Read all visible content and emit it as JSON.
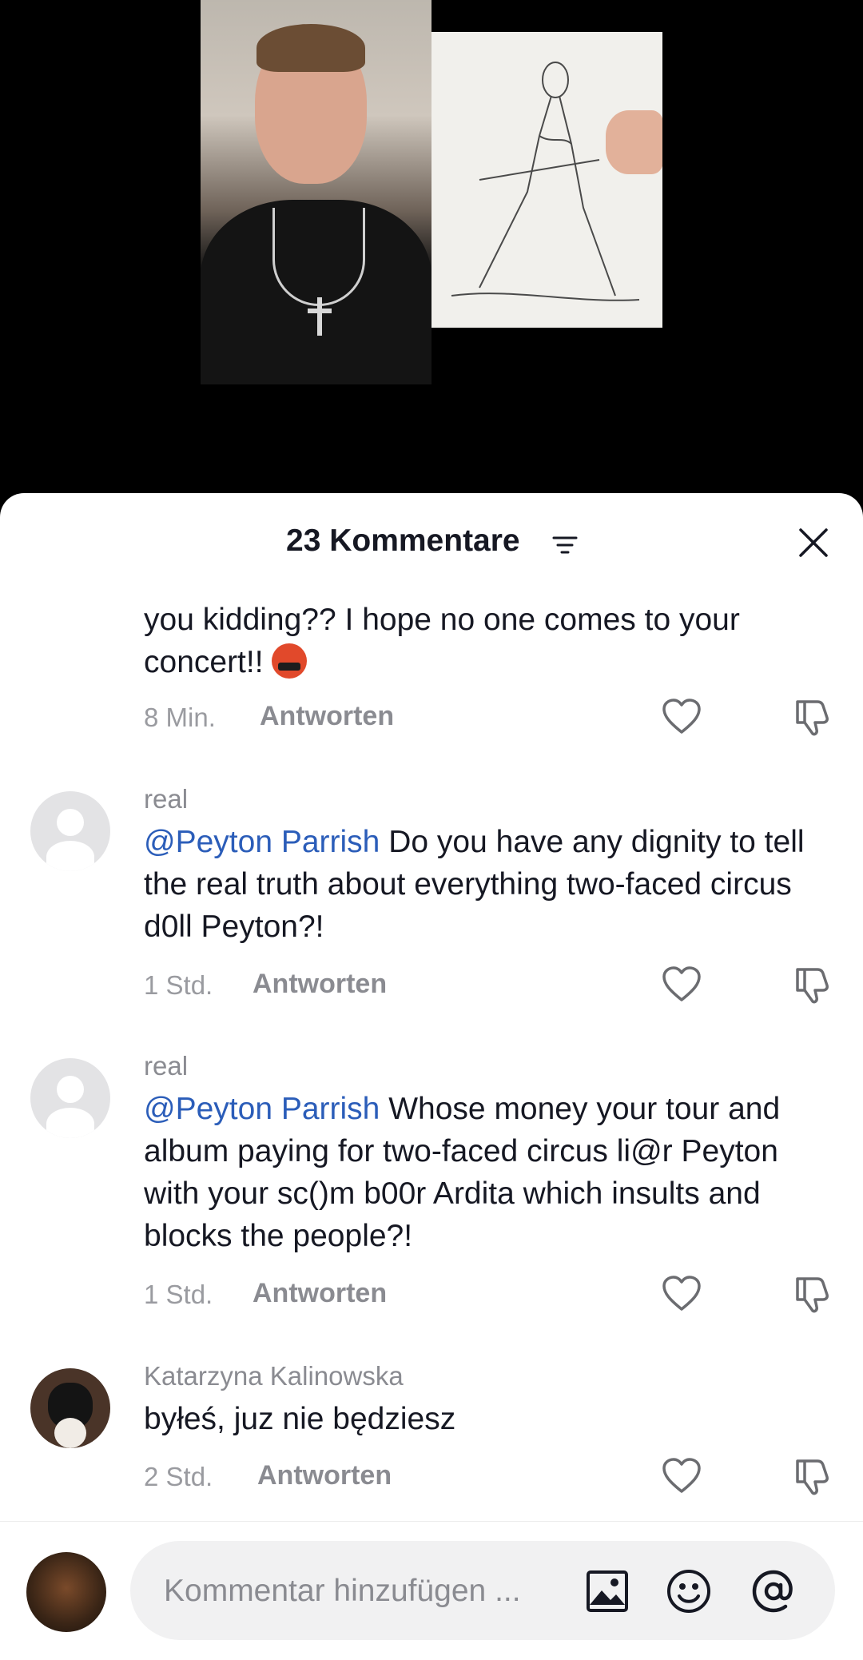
{
  "header": {
    "title": "23 Kommentare"
  },
  "comments": [
    {
      "username": "",
      "text": "you kidding?? I hope no one comes to your concert!!",
      "time": "8 Min.",
      "reply_label": "Antworten"
    },
    {
      "username": "real",
      "mention": "@Peyton Parrish",
      "text": " Do you have any dignity to tell the real truth about everything two-faced circus d0ll Peyton?!",
      "time": "1 Std.",
      "reply_label": "Antworten"
    },
    {
      "username": "real",
      "mention": "@Peyton Parrish",
      "text": " Whose money your tour and album paying for two-faced circus li@r Peyton with your sc()m b00r Ardita which insults and blocks the people?!",
      "time": "1 Std.",
      "reply_label": "Antworten"
    },
    {
      "username": "Katarzyna Kalinowska",
      "text": "byłeś, juz nie będziesz",
      "time": "2 Std.",
      "reply_label": "Antworten"
    }
  ],
  "composer": {
    "placeholder": "Kommentar hinzufügen ..."
  },
  "icons": {
    "filter": "filter-icon",
    "close": "close-icon",
    "like": "heart-icon",
    "dislike": "thumbs-down-icon",
    "image": "image-icon",
    "emoji": "emoji-icon",
    "mention": "at-icon"
  },
  "colors": {
    "mention": "#2b5db9",
    "text": "#161823",
    "secondary": "#8a8b91"
  }
}
